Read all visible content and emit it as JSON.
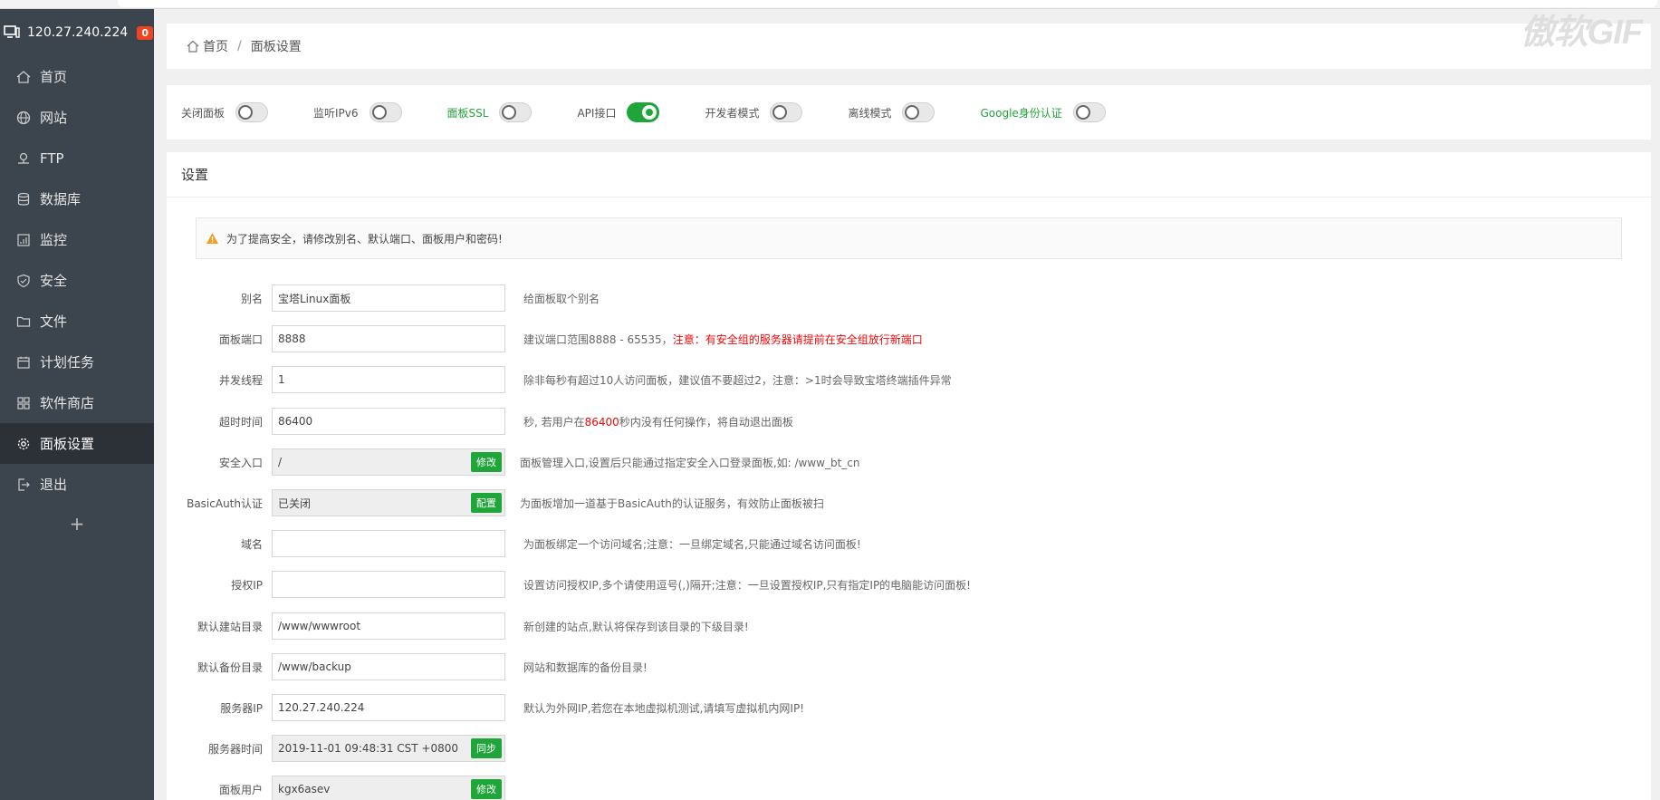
{
  "sidebar": {
    "server_ip": "120.27.240.224",
    "badge_count": "0",
    "items": [
      {
        "label": "首页",
        "icon": "home-icon"
      },
      {
        "label": "网站",
        "icon": "globe-icon"
      },
      {
        "label": "FTP",
        "icon": "ftp-icon"
      },
      {
        "label": "数据库",
        "icon": "database-icon"
      },
      {
        "label": "监控",
        "icon": "monitor-icon"
      },
      {
        "label": "安全",
        "icon": "shield-icon"
      },
      {
        "label": "文件",
        "icon": "folder-icon"
      },
      {
        "label": "计划任务",
        "icon": "calendar-icon"
      },
      {
        "label": "软件商店",
        "icon": "apps-icon"
      },
      {
        "label": "面板设置",
        "icon": "gear-icon",
        "active": true
      },
      {
        "label": "退出",
        "icon": "logout-icon"
      }
    ],
    "add_label": "+"
  },
  "breadcrumb": {
    "home": "首页",
    "separator": "/",
    "current": "面板设置"
  },
  "toggles": [
    {
      "label": "关闭面板",
      "on": false,
      "green": false
    },
    {
      "label": "监听IPv6",
      "on": false,
      "green": false
    },
    {
      "label": "面板SSL",
      "on": false,
      "green": true
    },
    {
      "label": "API接口",
      "on": true,
      "green": false
    },
    {
      "label": "开发者模式",
      "on": false,
      "green": false
    },
    {
      "label": "离线模式",
      "on": false,
      "green": false
    },
    {
      "label": "Google身份认证",
      "on": false,
      "green": true
    }
  ],
  "settings": {
    "title": "设置",
    "alert": "为了提高安全，请修改别名、默认端口、面板用户和密码!",
    "rows": [
      {
        "label": "别名",
        "value": "宝塔Linux面板",
        "hint": "给面板取个别名"
      },
      {
        "label": "面板端口",
        "value": "8888",
        "hint": "建议端口范围8888 - 65535，",
        "hint_red": "注意：有安全组的服务器请提前在安全组放行新端口"
      },
      {
        "label": "并发线程",
        "value": "1",
        "hint": "除非每秒有超过10人访问面板，建议值不要超过2，注意：>1时会导致宝塔终端插件异常"
      },
      {
        "label": "超时时间",
        "value": "86400",
        "hint_pre": "秒, 若用户在",
        "hint_red": "86400",
        "hint_post": "秒内没有任何操作，将自动退出面板"
      },
      {
        "label": "安全入口",
        "value": "/",
        "button": "修改",
        "hint": "面板管理入口,设置后只能通过指定安全入口登录面板,如: /www_bt_cn"
      },
      {
        "label": "BasicAuth认证",
        "value": "已关闭",
        "button": "配置",
        "hint": "为面板增加一道基于BasicAuth的认证服务，有效防止面板被扫"
      },
      {
        "label": "域名",
        "value": "",
        "hint": "为面板绑定一个访问域名;注意：一旦绑定域名,只能通过域名访问面板!"
      },
      {
        "label": "授权IP",
        "value": "",
        "hint": "设置访问授权IP,多个请使用逗号(,)隔开;注意：一旦设置授权IP,只有指定IP的电脑能访问面板!"
      },
      {
        "label": "默认建站目录",
        "value": "/www/wwwroot",
        "hint": "新创建的站点,默认将保存到该目录的下级目录!"
      },
      {
        "label": "默认备份目录",
        "value": "/www/backup",
        "hint": "网站和数据库的备份目录!"
      },
      {
        "label": "服务器IP",
        "value": "120.27.240.224",
        "hint": "默认为外网IP,若您在本地虚拟机测试,请填写虚拟机内网IP!"
      },
      {
        "label": "服务器时间",
        "value": "2019-11-01 09:48:31 CST +0800",
        "button": "同步",
        "hint": ""
      },
      {
        "label": "面板用户",
        "value": "kgx6asev",
        "button": "修改",
        "hint": ""
      }
    ]
  },
  "watermark": "傲软GIF",
  "colors": {
    "sidebar_bg": "#3c444d",
    "accent_green": "#20a53a",
    "badge_red": "#f0431f",
    "warning_red": "#ef0808"
  }
}
